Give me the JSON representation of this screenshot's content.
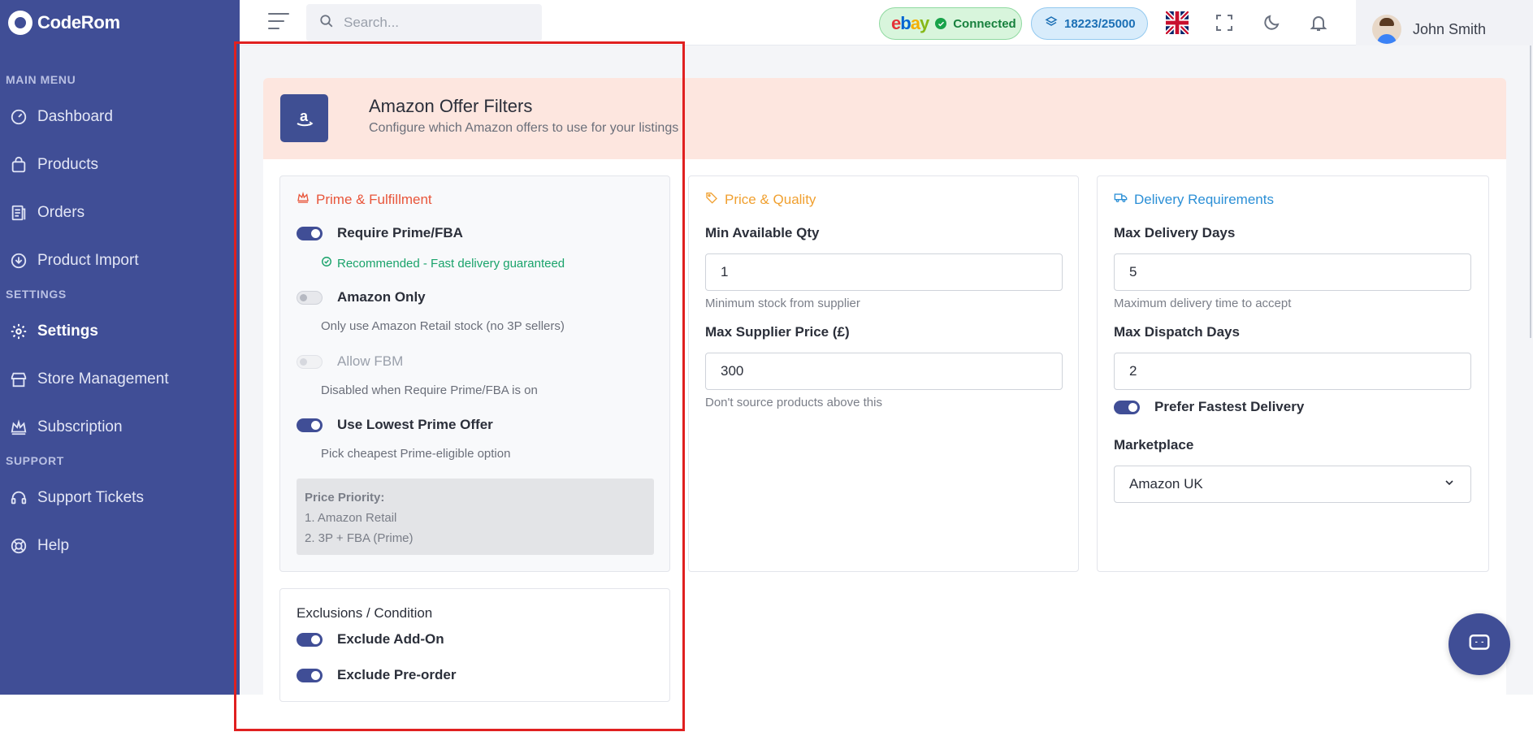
{
  "brand": {
    "name": "CodeRom"
  },
  "sidebar": {
    "sections": [
      {
        "title": "MAIN MENU"
      },
      {
        "title": "SETTINGS"
      },
      {
        "title": "SUPPORT"
      }
    ],
    "items": [
      {
        "label": "Dashboard",
        "icon": "dashboard-icon"
      },
      {
        "label": "Products",
        "icon": "bag-icon"
      },
      {
        "label": "Orders",
        "icon": "orders-icon"
      },
      {
        "label": "Product Import",
        "icon": "import-icon"
      },
      {
        "label": "Settings",
        "icon": "gear-icon"
      },
      {
        "label": "Store Management",
        "icon": "store-icon"
      },
      {
        "label": "Subscription",
        "icon": "crown-icon"
      },
      {
        "label": "Support Tickets",
        "icon": "headset-icon"
      },
      {
        "label": "Help",
        "icon": "lifebuoy-icon"
      }
    ]
  },
  "topbar": {
    "search_placeholder": "Search...",
    "ebay": {
      "logo": [
        "e",
        "b",
        "a",
        "y"
      ],
      "status": "Connected"
    },
    "credits": "18223/25000",
    "user_name": "John Smith"
  },
  "page": {
    "title": "Amazon Offer Filters",
    "subtitle": "Configure which Amazon offers to use for your listings"
  },
  "prime": {
    "title": "Prime & Fulfillment",
    "require_prime": {
      "label": "Require Prime/FBA",
      "on": true,
      "note": "Recommended - Fast delivery guaranteed"
    },
    "amazon_only": {
      "label": "Amazon Only",
      "on": false,
      "help": "Only use Amazon Retail stock (no 3P sellers)"
    },
    "allow_fbm": {
      "label": "Allow FBM",
      "on": false,
      "help": "Disabled when Require Prime/FBA is on"
    },
    "lowest_prime": {
      "label": "Use Lowest Prime Offer",
      "on": true,
      "help": "Pick cheapest Prime-eligible option"
    },
    "priority": {
      "heading": "Price Priority:",
      "lines": [
        "1. Amazon Retail",
        "2. 3P + FBA (Prime)"
      ]
    }
  },
  "price": {
    "title": "Price & Quality",
    "min_qty": {
      "label": "Min Available Qty",
      "value": "1",
      "help": "Minimum stock from supplier"
    },
    "max_price": {
      "label": "Max Supplier Price (£)",
      "value": "300",
      "help": "Don't source products above this"
    }
  },
  "delivery": {
    "title": "Delivery Requirements",
    "max_delivery": {
      "label": "Max Delivery Days",
      "value": "5",
      "help": "Maximum delivery time to accept"
    },
    "max_dispatch": {
      "label": "Max Dispatch Days",
      "value": "2"
    },
    "prefer_fastest": {
      "label": "Prefer Fastest Delivery",
      "on": true
    },
    "marketplace": {
      "label": "Marketplace",
      "value": "Amazon UK"
    }
  },
  "exclusions": {
    "title": "Exclusions / Condition",
    "add_on": {
      "label": "Exclude Add-On",
      "on": true
    },
    "pre_order": {
      "label": "Exclude Pre-order",
      "on": true
    }
  },
  "colors": {
    "sidebar": "#404e96",
    "prime_accent": "#e8553a",
    "price_accent": "#f0a030",
    "delivery_accent": "#2b8fd6",
    "success": "#1aa36b",
    "highlight": "#e02020"
  }
}
